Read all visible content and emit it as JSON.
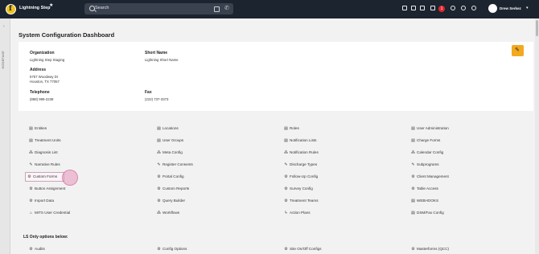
{
  "topbar": {
    "logo_letter": "f",
    "app_name": "Lightning Step",
    "search_placeholder": "Search",
    "notification_count": "1",
    "user_name": "Drew Serkez"
  },
  "sidebar": {
    "label": "HOMEPAGE"
  },
  "page": {
    "title": "System Configuration Dashboard"
  },
  "org": {
    "organization_label": "Organization",
    "organization_value": "Lightning Step Staging",
    "short_name_label": "Short Name",
    "short_name_value": "Lightning Short Name",
    "address_label": "Address",
    "address_line1": "5757 Woodway Dr",
    "address_line2": "Houston, TX 77057",
    "telephone_label": "Telephone",
    "telephone_value": "(888) 999-2238",
    "fax_label": "Fax",
    "fax_value": "(222) 737-3373"
  },
  "config_links": [
    [
      "Entities",
      "Locations",
      "Roles",
      "User Administration"
    ],
    [
      "Treatment Units",
      "User Groups",
      "Notification Lists",
      "Charge Forms"
    ],
    [
      "Diagnosis List",
      "Meta Config",
      "Notification Rules",
      "Calendar Config"
    ],
    [
      "Narrative Rules",
      "Register Consents",
      "Discharge Types",
      "Subprograms"
    ],
    [
      "Custom Forms",
      "Portal Config",
      "Follow-Up Config",
      "Client Management"
    ],
    [
      "Button Assignment",
      "Custom Reports",
      "Survey Config",
      "Table Access"
    ],
    [
      "Import Data",
      "Query Builder",
      "Treatment Teams",
      "WEBHOOKS"
    ],
    [
      "MITS User Credential",
      "Workflows",
      "Action Plans",
      "DSM/Fax Config"
    ]
  ],
  "ls_only": {
    "title": "LS Only options below:",
    "links": [
      "Audits",
      "Config Options",
      "Site On/Off Configs",
      "Masterforms (QCC)"
    ]
  }
}
